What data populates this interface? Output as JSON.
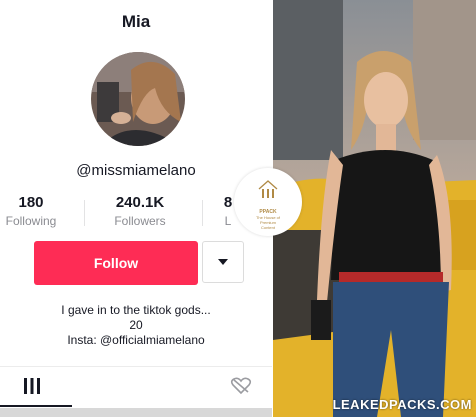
{
  "profile": {
    "title": "Mia",
    "handle": "@missmiamelano",
    "stats": [
      {
        "value": "180",
        "label": "Following"
      },
      {
        "value": "240.1K",
        "label": "Followers"
      },
      {
        "value": "8",
        "label": "L"
      }
    ],
    "follow_label": "Follow",
    "bio_line1": "I gave in to the tiktok gods...",
    "bio_line2": "20",
    "bio_line3": "Insta: @officialmiamelano"
  },
  "badge": {
    "name": "PPACK",
    "tagline1": "The House of",
    "tagline2": "Premium",
    "tagline3": "Content"
  },
  "watermark": "LEAKEDPACKS.COM",
  "icons": {
    "dropdown": "caret-down-icon",
    "videos_tab": "grid-icon",
    "liked_tab": "liked-heart-icon"
  },
  "colors": {
    "follow_button": "#fe2c55",
    "text": "#161823",
    "muted": "#8a8b91"
  }
}
